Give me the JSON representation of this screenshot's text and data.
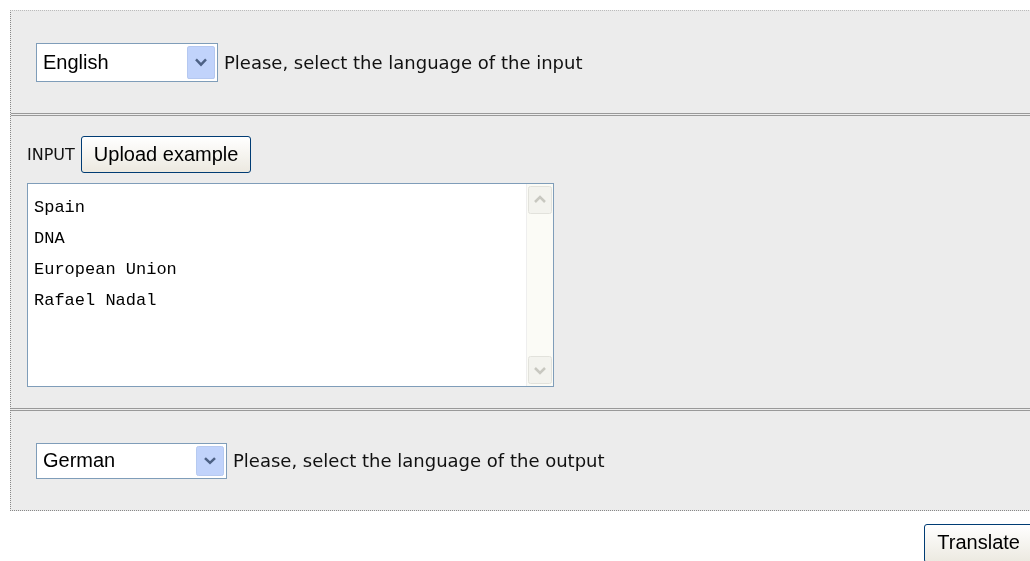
{
  "input_language": {
    "value": "English",
    "hint": "Please, select the language of the input"
  },
  "input": {
    "label": "INPUT",
    "upload_button": "Upload example",
    "lines": [
      "Spain",
      "DNA",
      "European Union",
      "Rafael Nadal"
    ]
  },
  "output_language": {
    "value": "German",
    "hint": "Please, select the language of the output"
  },
  "translate_button": "Translate"
}
